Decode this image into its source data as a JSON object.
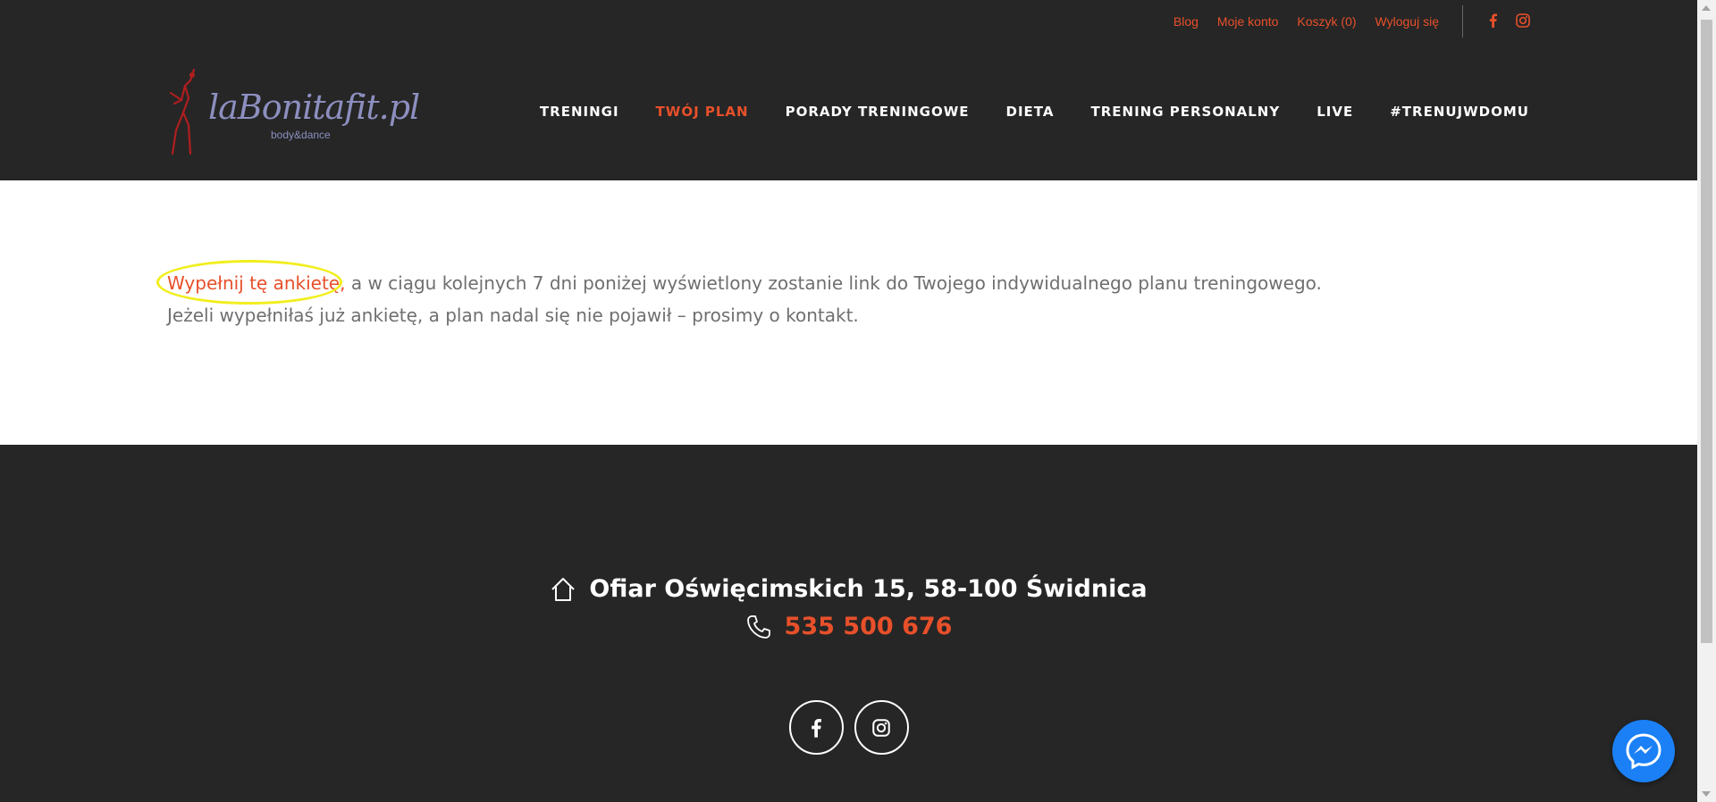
{
  "top_links": [
    "Blog",
    "Moje konto",
    "Koszyk (0)",
    "Wyloguj się"
  ],
  "logo": {
    "text": "laBonitafit.pl",
    "sub": "body&dance"
  },
  "nav": [
    {
      "label": "TRENINGI"
    },
    {
      "label": "TWÓJ PLAN"
    },
    {
      "label": "PORADY TRENINGOWE"
    },
    {
      "label": "DIETA"
    },
    {
      "label": "TRENING PERSONALNY"
    },
    {
      "label": "LIVE"
    },
    {
      "label": "#TRENUJWDOMU"
    }
  ],
  "content": {
    "link": "Wypełnij tę ankietę,",
    "line1_rest": " a w ciągu kolejnych 7 dni poniżej wyświetlony zostanie link do Twojego indywidualnego planu treningowego.",
    "line2": "Jeżeli wypełniłaś już ankietę, a plan nadal się nie pojawił – prosimy o kontakt."
  },
  "footer": {
    "address": "Ofiar Oświęcimskich 15, 58-100 Świdnica",
    "phone": "535 500 676"
  },
  "colors": {
    "accent": "#e8502a",
    "dark": "#262626",
    "highlight": "#f1ee1c",
    "messenger": "#1b80f5"
  }
}
